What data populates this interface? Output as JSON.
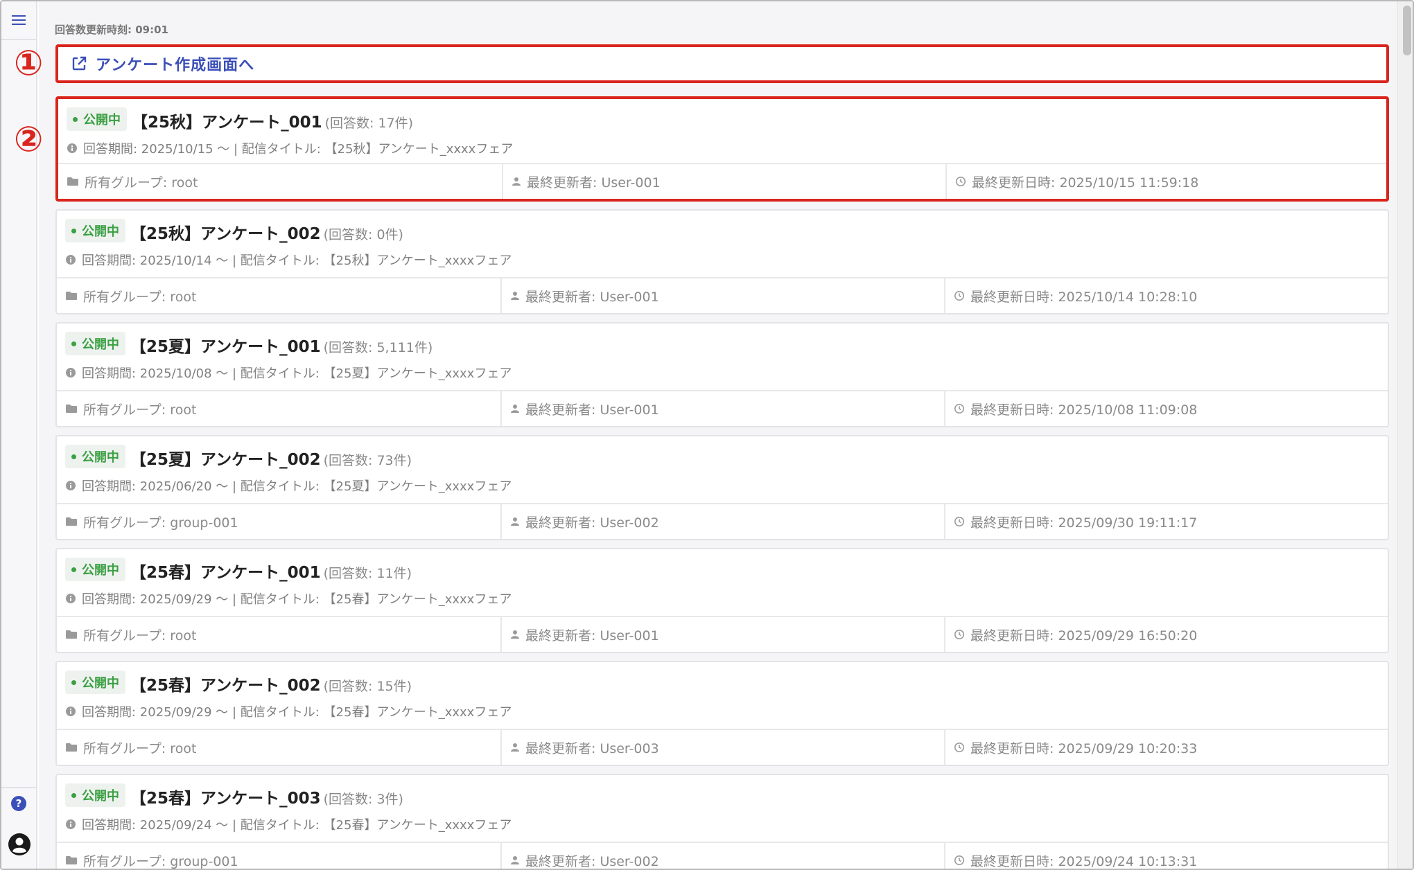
{
  "header": {
    "updated_label": "回答数更新時刻: 09:01"
  },
  "annotations": {
    "one": "①",
    "two": "②"
  },
  "create_link": {
    "label": "アンケート作成画面へ"
  },
  "surveys": [
    {
      "status": "公開中",
      "title": "【25秋】アンケート_001",
      "count": "(回答数: 17件)",
      "period": "回答期間: 2025/10/15 〜 | 配信タイトル: 【25秋】アンケート_xxxxフェア",
      "group": "所有グループ: root",
      "updater": "最終更新者: User-001",
      "updated_at": "最終更新日時: 2025/10/15 11:59:18"
    },
    {
      "status": "公開中",
      "title": "【25秋】アンケート_002",
      "count": "(回答数: 0件)",
      "period": "回答期間: 2025/10/14 〜 | 配信タイトル: 【25秋】アンケート_xxxxフェア",
      "group": "所有グループ: root",
      "updater": "最終更新者: User-001",
      "updated_at": "最終更新日時: 2025/10/14 10:28:10"
    },
    {
      "status": "公開中",
      "title": "【25夏】アンケート_001",
      "count": "(回答数: 5,111件)",
      "period": "回答期間: 2025/10/08 〜 | 配信タイトル: 【25夏】アンケート_xxxxフェア",
      "group": "所有グループ: root",
      "updater": "最終更新者: User-001",
      "updated_at": "最終更新日時: 2025/10/08 11:09:08"
    },
    {
      "status": "公開中",
      "title": "【25夏】アンケート_002",
      "count": "(回答数: 73件)",
      "period": "回答期間: 2025/06/20 〜 | 配信タイトル: 【25夏】アンケート_xxxxフェア",
      "group": "所有グループ: group-001",
      "updater": "最終更新者: User-002",
      "updated_at": "最終更新日時: 2025/09/30 19:11:17"
    },
    {
      "status": "公開中",
      "title": "【25春】アンケート_001",
      "count": "(回答数: 11件)",
      "period": "回答期間: 2025/09/29 〜 | 配信タイトル: 【25春】アンケート_xxxxフェア",
      "group": "所有グループ: root",
      "updater": "最終更新者: User-001",
      "updated_at": "最終更新日時: 2025/09/29 16:50:20"
    },
    {
      "status": "公開中",
      "title": "【25春】アンケート_002",
      "count": "(回答数: 15件)",
      "period": "回答期間: 2025/09/29 〜 | 配信タイトル: 【25春】アンケート_xxxxフェア",
      "group": "所有グループ: root",
      "updater": "最終更新者: User-003",
      "updated_at": "最終更新日時: 2025/09/29 10:20:33"
    },
    {
      "status": "公開中",
      "title": "【25春】アンケート_003",
      "count": "(回答数: 3件)",
      "period": "回答期間: 2025/09/24 〜 | 配信タイトル: 【25春】アンケート_xxxxフェア",
      "group": "所有グループ: group-001",
      "updater": "最終更新者: User-002",
      "updated_at": "最終更新日時: 2025/09/24 10:13:31"
    }
  ],
  "icons": {
    "menu": "hamburger-menu-icon",
    "help": "help-circle-icon",
    "account": "account-circle-icon",
    "external": "open-in-new-icon",
    "info": "info-icon",
    "folder": "folder-icon",
    "person": "person-icon",
    "clock": "clock-icon"
  },
  "colors": {
    "accent": "#3b4fb8",
    "status_green": "#3aa042",
    "annotation_red": "#d9251d"
  }
}
